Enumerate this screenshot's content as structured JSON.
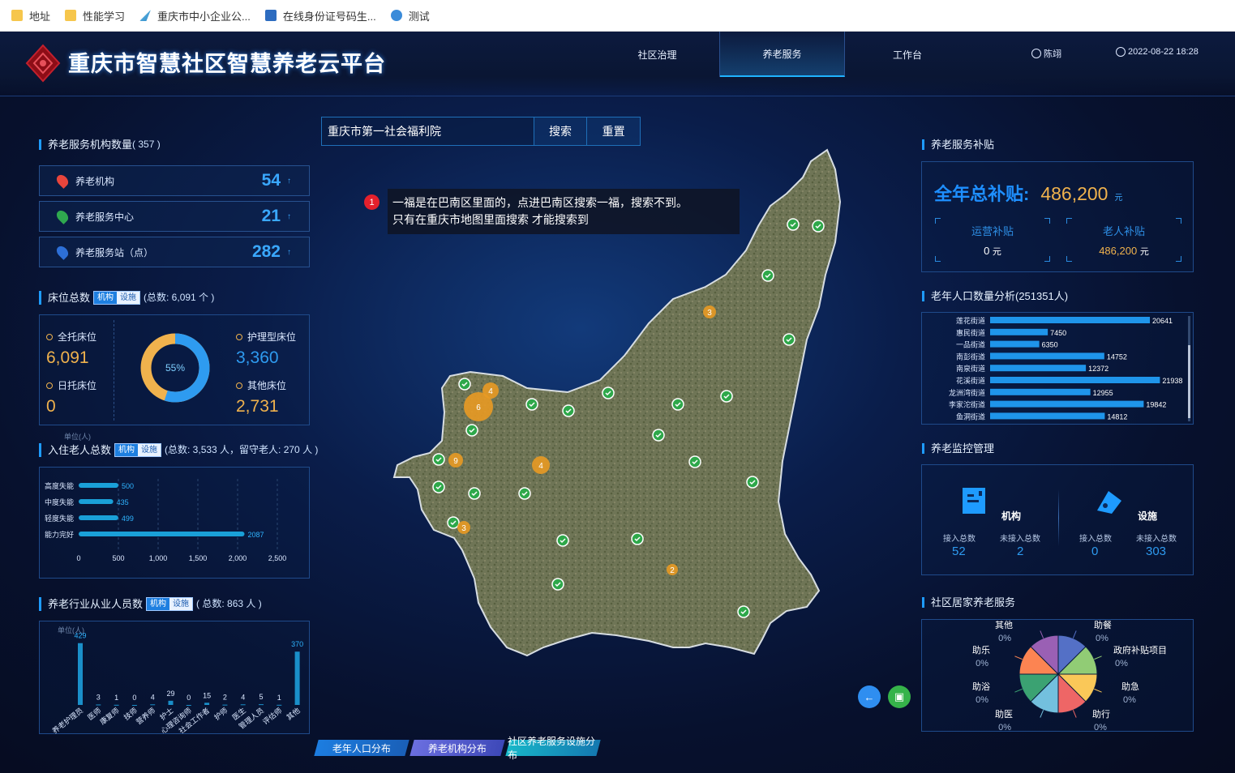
{
  "bookmarks": [
    {
      "label": "地址",
      "icon": "folder-icon"
    },
    {
      "label": "性能学习",
      "icon": "folder-icon"
    },
    {
      "label": "重庆市中小企业公...",
      "icon": "site-icon"
    },
    {
      "label": "在线身份证号码生...",
      "icon": "id-icon"
    },
    {
      "label": "测试",
      "icon": "web-icon"
    }
  ],
  "header": {
    "title": "重庆市智慧社区智慧养老云平台",
    "nav": [
      "社区治理",
      "养老服务",
      "工作台"
    ],
    "active_nav": "养老服务",
    "user": "陈翊",
    "datetime": "2022-08-22 18:28"
  },
  "search": {
    "value": "重庆市第一社会福利院",
    "search_label": "搜索",
    "reset_label": "重置"
  },
  "annotation": {
    "number": "1",
    "line1": "一福是在巴南区里面的，点进巴南区搜索一福，搜索不到。",
    "line2": "只有在重庆市地图里面搜索 才能搜索到"
  },
  "institutions": {
    "title": "养老服务机构数量",
    "total": "( 357 )",
    "rows": [
      {
        "label": "养老机构",
        "value": "54",
        "color": "#e8453c"
      },
      {
        "label": "养老服务中心",
        "value": "21",
        "color": "#2fa84f"
      },
      {
        "label": "养老服务站（点）",
        "value": "282",
        "color": "#2d6fd6"
      }
    ],
    "arrow": "↑"
  },
  "beds": {
    "title": "床位总数",
    "toggle": [
      "机构",
      "设施"
    ],
    "total": "(总数: 6,091 个 )",
    "items": [
      {
        "label": "全托床位",
        "value": "6,091",
        "color": "#f0b24d"
      },
      {
        "label": "日托床位",
        "value": "0",
        "color": "#f0b24d"
      },
      {
        "label": "护理型床位",
        "value": "3,360",
        "color": "#2e9bf0"
      },
      {
        "label": "其他床位",
        "value": "2,731",
        "color": "#f0b24d"
      }
    ],
    "donut_label": "55%",
    "donut_fraction": 0.55,
    "colors": {
      "primary": "#2e9bf0",
      "secondary": "#f0b24d"
    }
  },
  "residents": {
    "title": "入住老人总数",
    "toggle": [
      "机构",
      "设施"
    ],
    "total": "(总数: 3,533 人，留守老人: 270 人 )",
    "unit": "单位(人)",
    "chart_data": {
      "type": "bar",
      "orientation": "horizontal",
      "categories": [
        "高度失能",
        "中度失能",
        "轻度失能",
        "能力完好"
      ],
      "values": [
        500,
        435,
        499,
        2087
      ],
      "xlim": [
        0,
        2500
      ],
      "xticks": [
        "0",
        "500",
        "1,000",
        "1,500",
        "2,000",
        "2,500"
      ],
      "grid": true
    }
  },
  "staff": {
    "title": "养老行业从业人员数",
    "toggle": [
      "机构",
      "设施"
    ],
    "total": "( 总数: 863 人 )",
    "unit": "单位(人)",
    "chart_data": {
      "type": "bar",
      "categories": [
        "养老护理员",
        "医师",
        "康复师",
        "技师",
        "营养师",
        "护士",
        "心理咨询师",
        "社会工作者",
        "护师",
        "医生",
        "管理人员",
        "评估师",
        "其他"
      ],
      "values": [
        429,
        3,
        1,
        0,
        4,
        29,
        0,
        15,
        2,
        4,
        5,
        1,
        370
      ],
      "ylim": [
        0,
        450
      ]
    }
  },
  "subsidy": {
    "title": "养老服务补贴",
    "total_label": "全年总补贴:",
    "total_value": "486,200",
    "total_unit": "元",
    "items": [
      {
        "label": "运营补贴",
        "value": "0",
        "unit": "元"
      },
      {
        "label": "老人补贴",
        "value": "486,200",
        "unit": "元"
      }
    ]
  },
  "population": {
    "title": "老年人口数量分析(251351人)",
    "chart_data": {
      "type": "bar",
      "orientation": "horizontal",
      "categories": [
        "莲花街道",
        "惠民街道",
        "一品街道",
        "南彭街道",
        "南泉街道",
        "花溪街道",
        "龙洲湾街道",
        "李家沱街道",
        "鱼洞街道"
      ],
      "values": [
        20641,
        7450,
        6350,
        14752,
        12372,
        21938,
        12955,
        19842,
        14812
      ],
      "xlim": [
        0,
        22000
      ]
    }
  },
  "monitor": {
    "title": "养老监控管理",
    "groups": [
      {
        "name": "机构",
        "items": [
          {
            "label": "接入总数",
            "value": "52"
          },
          {
            "label": "未接入总数",
            "value": "2"
          }
        ]
      },
      {
        "name": "设施",
        "items": [
          {
            "label": "接入总数",
            "value": "0"
          },
          {
            "label": "未接入总数",
            "value": "303"
          }
        ]
      }
    ]
  },
  "home_service": {
    "title": "社区居家养老服务",
    "chart_data": {
      "type": "pie",
      "categories": [
        "助餐",
        "政府补贴项目",
        "助急",
        "助行",
        "助医",
        "助浴",
        "助乐",
        "其他"
      ],
      "values": [
        1,
        1,
        1,
        1,
        1,
        1,
        1,
        1
      ],
      "labels": [
        "0%",
        "0%",
        "0%",
        "0%",
        "0%",
        "0%",
        "0%",
        "0%"
      ],
      "colors": [
        "#5470c6",
        "#91cc75",
        "#fac858",
        "#ee6666",
        "#73c0de",
        "#3ba272",
        "#fc8452",
        "#9a60b4"
      ]
    }
  },
  "bottom_tabs": [
    "老年人口分布",
    "养老机构分布",
    "社区养老服务设施分布"
  ],
  "map": {
    "clusters": [
      "3",
      "4",
      "6",
      "9",
      "4",
      "3",
      "2"
    ]
  }
}
